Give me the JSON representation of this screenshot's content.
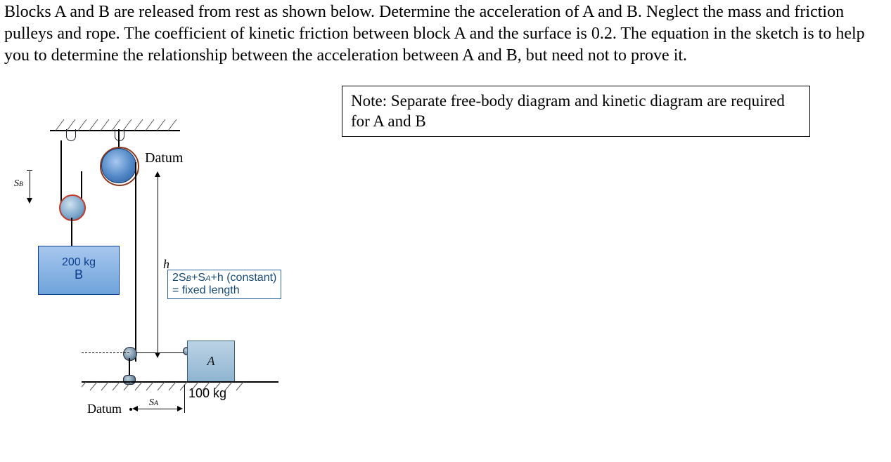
{
  "problem": {
    "text": "Blocks A and B are released from rest as shown below. Determine the acceleration of A and B. Neglect the mass and friction pulleys and rope. The coefficient of kinetic friction between block A and the surface is 0.2. The equation in the sketch is to help you to determine the relationship between the acceleration between A and B, but need not to prove it."
  },
  "note": {
    "text": "Note: Separate free-body diagram and kinetic diagram are required for A and B"
  },
  "figure": {
    "labels": {
      "datum_top": "Datum",
      "datum_bottom": "Datum",
      "sb": "S",
      "sb_sub": "B",
      "sa": "S",
      "sa_sub": "A",
      "h": "h",
      "blockB_mass": "200 kg",
      "blockB_name": "B",
      "blockA_name": "A",
      "blockA_mass": "100 kg",
      "eq_line1_pre": "2S",
      "eq_line1_sub1": "B",
      "eq_line1_mid": "+S",
      "eq_line1_sub2": "A",
      "eq_line1_post": "+h (constant)",
      "eq_line2": "= fixed length"
    }
  }
}
